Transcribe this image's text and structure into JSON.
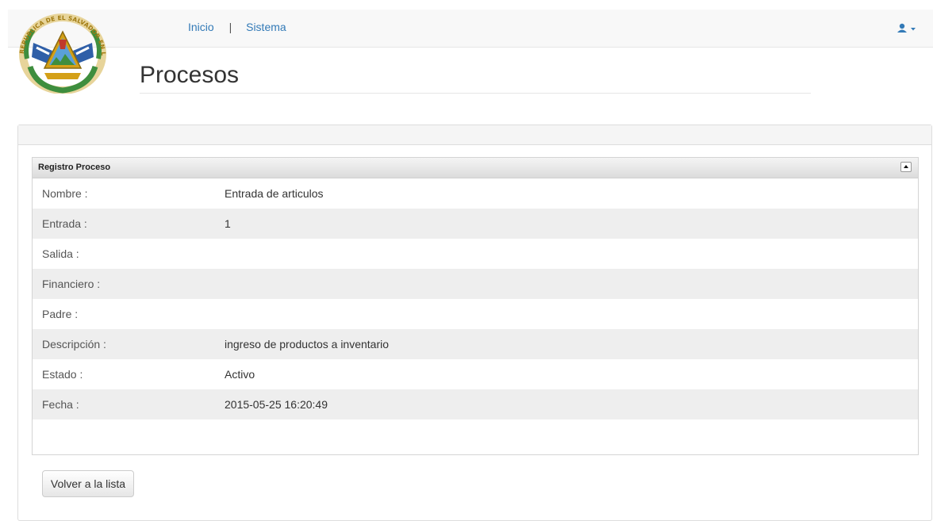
{
  "nav": {
    "links": [
      "Inicio",
      "Sistema"
    ],
    "separator": "|"
  },
  "logo": {
    "text": "REPUBLICA DE EL SALVADOR EN LA AMERICA CENTRAL",
    "colors": {
      "gold": "#d4a017",
      "green": "#3e8e3e",
      "blue": "#2f5fa8"
    }
  },
  "page": {
    "title": "Procesos"
  },
  "record": {
    "title": "Registro Proceso",
    "rows": [
      {
        "label": "Nombre :",
        "value": "Entrada de articulos"
      },
      {
        "label": "Entrada :",
        "value": "1"
      },
      {
        "label": "Salida :",
        "value": ""
      },
      {
        "label": "Financiero :",
        "value": ""
      },
      {
        "label": "Padre :",
        "value": ""
      },
      {
        "label": "Descripción :",
        "value": "ingreso de productos a inventario"
      },
      {
        "label": "Estado :",
        "value": "Activo"
      },
      {
        "label": "Fecha :",
        "value": "2015-05-25 16:20:49"
      }
    ]
  },
  "actions": {
    "back_label": "Volver a la lista"
  },
  "icons": {
    "user_menu": "user-icon",
    "collapse": "collapse-up-icon"
  },
  "colors": {
    "link": "#337ab7",
    "navbar_bg": "#f8f8f8",
    "row_alt": "#eeeeee"
  }
}
